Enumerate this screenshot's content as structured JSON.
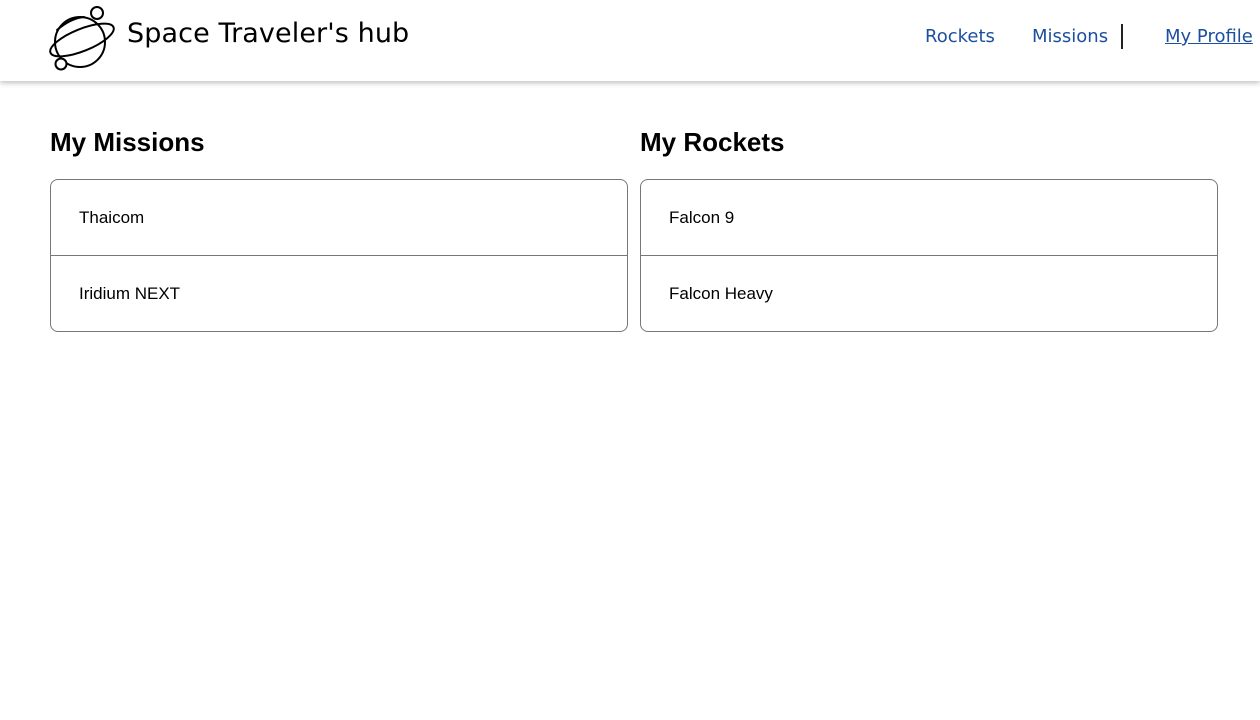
{
  "header": {
    "brand": "Space Traveler's hub",
    "logo_icon": "planet-icon",
    "nav": {
      "rockets": "Rockets",
      "missions": "Missions",
      "profile": "My Profile"
    },
    "link_color": "#1d4fa0"
  },
  "missions": {
    "title": "My Missions",
    "items": [
      "Thaicom",
      "Iridium NEXT"
    ]
  },
  "rockets": {
    "title": "My Rockets",
    "items": [
      "Falcon 9",
      "Falcon Heavy"
    ]
  }
}
